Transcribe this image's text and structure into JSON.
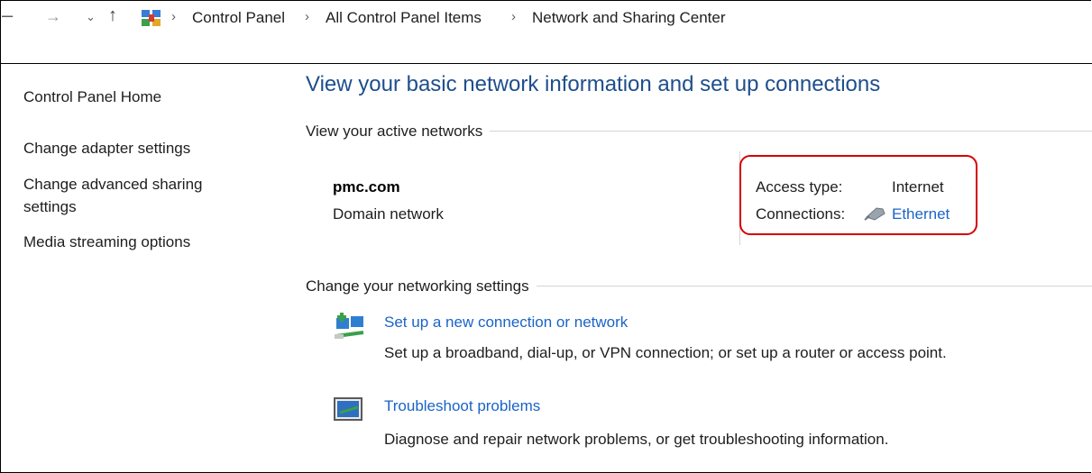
{
  "breadcrumb": {
    "items": [
      "Control Panel",
      "All Control Panel Items",
      "Network and Sharing Center"
    ]
  },
  "sidebar": {
    "home": "Control Panel Home",
    "items": [
      "Change adapter settings",
      "Change advanced sharing settings",
      "Media streaming options"
    ]
  },
  "main": {
    "title": "View your basic network information and set up connections",
    "active_section": "View your active networks",
    "network": {
      "name": "pmc.com",
      "type": "Domain network",
      "access_label": "Access type:",
      "access_value": "Internet",
      "connections_label": "Connections:",
      "connections_value": "Ethernet"
    },
    "settings_section": "Change your networking settings",
    "tasks": [
      {
        "title": "Set up a new connection or network",
        "desc": "Set up a broadband, dial-up, or VPN connection; or set up a router or access point."
      },
      {
        "title": "Troubleshoot problems",
        "desc": "Diagnose and repair network problems, or get troubleshooting information."
      }
    ]
  },
  "icons": {
    "back": "back-arrow-icon",
    "forward": "forward-arrow-icon",
    "recent": "chevron-down-icon",
    "up": "up-arrow-icon",
    "location": "control-panel-icon",
    "ethernet": "ethernet-icon",
    "new_connection": "new-connection-icon",
    "troubleshoot": "troubleshoot-icon"
  },
  "colors": {
    "link": "#1a64c8",
    "title": "#1e4e8c",
    "callout": "#d40000"
  }
}
